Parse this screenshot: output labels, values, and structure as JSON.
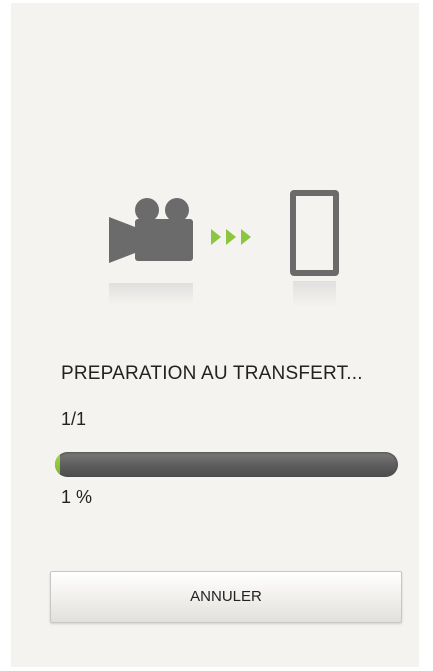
{
  "transfer": {
    "status_text": "PREPARATION AU TRANSFERT...",
    "counter": "1/1",
    "progress_percent": 1,
    "percent_label": "1 %"
  },
  "actions": {
    "cancel_label": "ANNULER"
  },
  "illustration": {
    "source_icon": "video-camera-icon",
    "direction_icon": "arrows-right-icon",
    "target_icon": "smartphone-icon",
    "icon_color": "#6b6b6b",
    "accent_color": "#8cc63f"
  },
  "colors": {
    "background": "#f5f3f0",
    "progress_track": "#5c5c5c",
    "progress_fill": "#8cc63f"
  }
}
